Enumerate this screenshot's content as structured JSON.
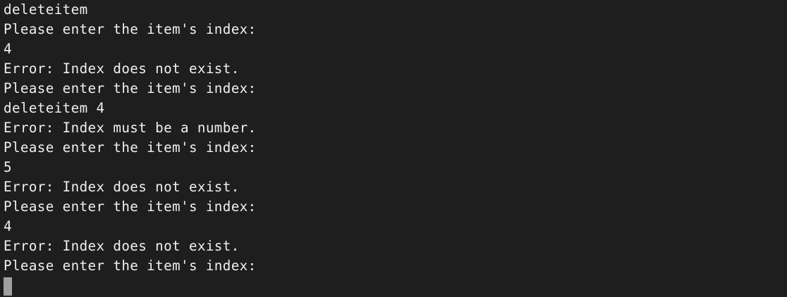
{
  "terminal": {
    "lines": [
      "deleteitem",
      "Please enter the item's index:",
      "4",
      "Error: Index does not exist.",
      "Please enter the item's index:",
      "deleteitem 4",
      "Error: Index must be a number.",
      "Please enter the item's index:",
      "5",
      "Error: Index does not exist.",
      "Please enter the item's index:",
      "4",
      "Error: Index does not exist.",
      "Please enter the item's index:"
    ]
  }
}
